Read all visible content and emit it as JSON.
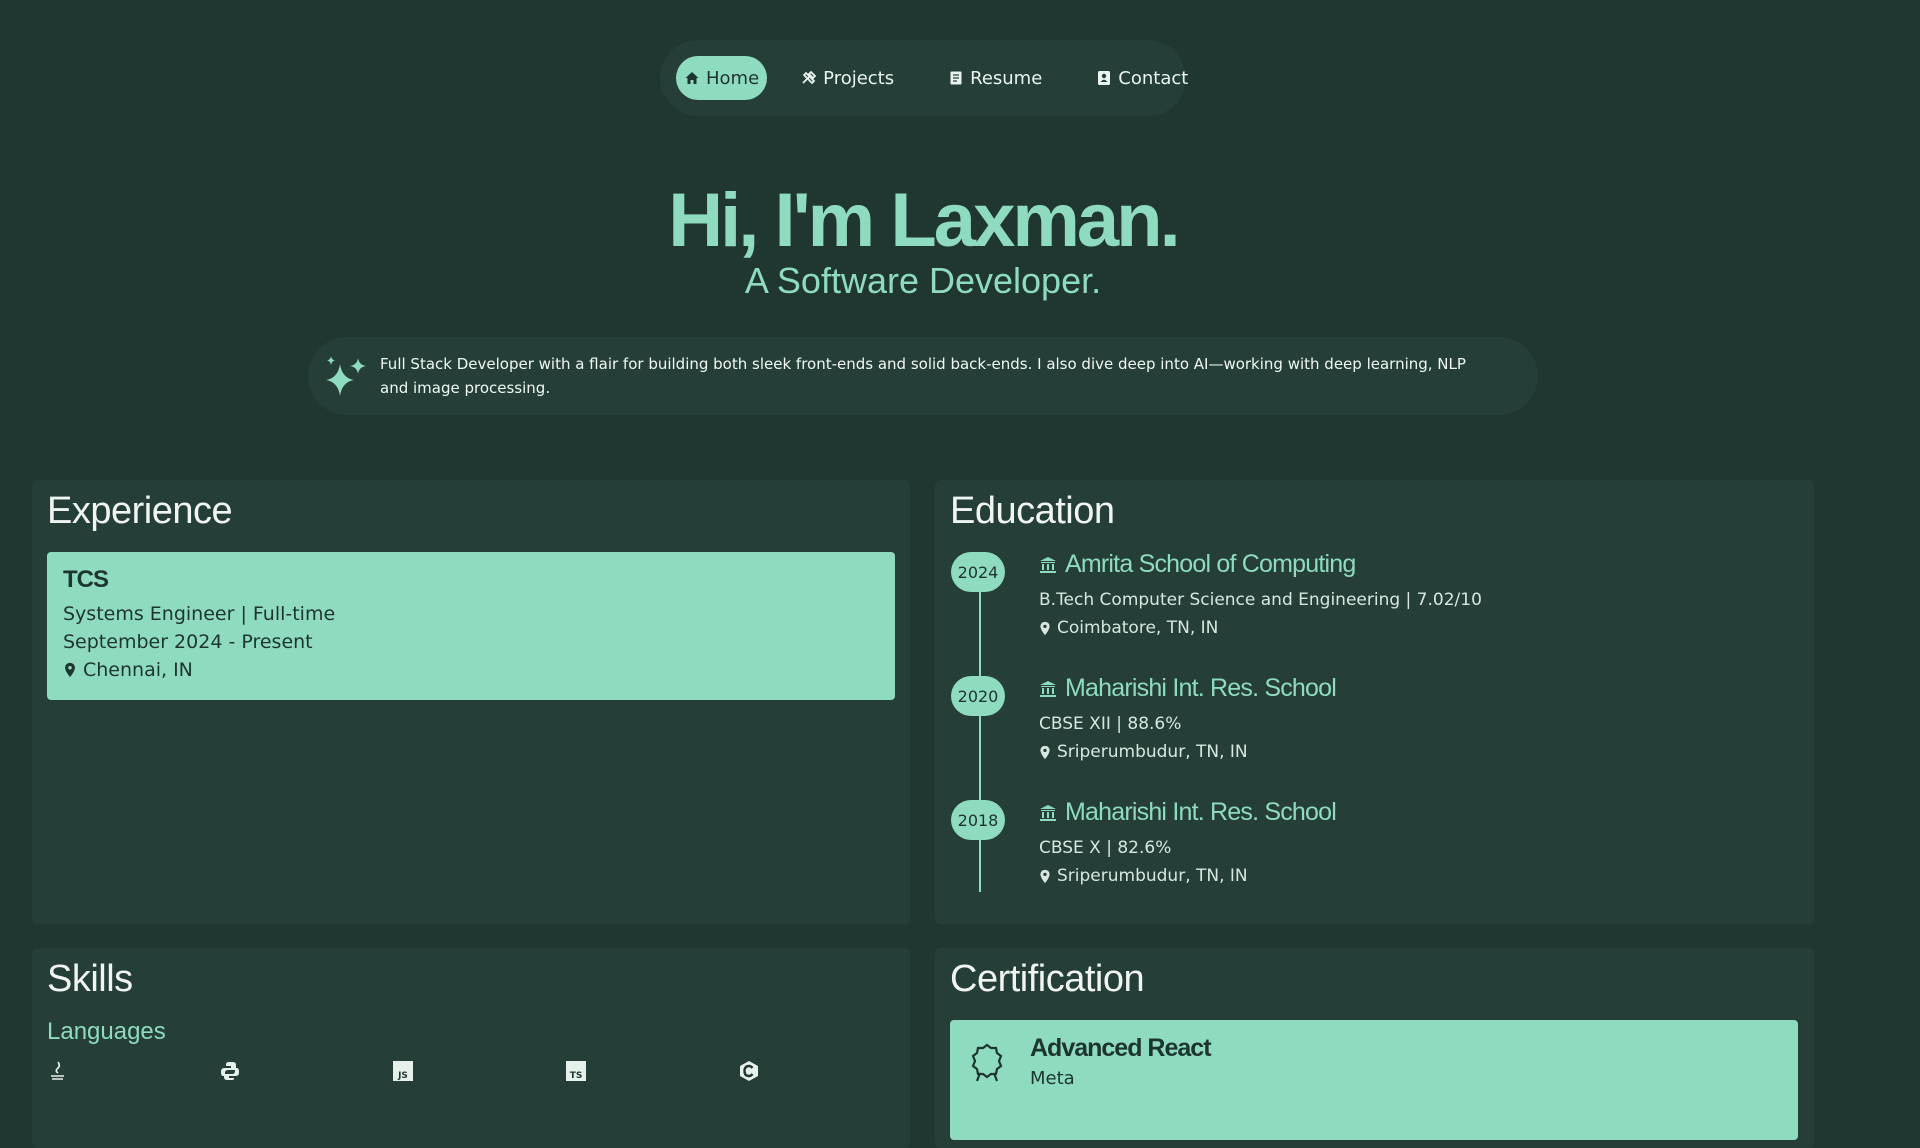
{
  "nav": {
    "items": [
      {
        "label": "Home",
        "icon": "home-icon",
        "active": true
      },
      {
        "label": "Projects",
        "icon": "tools-icon",
        "active": false
      },
      {
        "label": "Resume",
        "icon": "document-icon",
        "active": false
      },
      {
        "label": "Contact",
        "icon": "contact-card-icon",
        "active": false
      }
    ]
  },
  "hero": {
    "title": "Hi, I'm Laxman.",
    "subtitle": "A Software Developer.",
    "intro": "Full Stack Developer with a flair for building both sleek front-ends and solid back-ends. I also dive deep into AI—working with deep learning, NLP and image processing."
  },
  "experience": {
    "title": "Experience",
    "items": [
      {
        "company": "TCS",
        "role": "Systems Engineer | Full-time",
        "dates": "September 2024 - Present",
        "location": "Chennai, IN"
      }
    ]
  },
  "education": {
    "title": "Education",
    "items": [
      {
        "year": "2024",
        "school": "Amrita School of Computing",
        "detail": "B.Tech Computer Science and Engineering | 7.02/10",
        "location": "Coimbatore, TN, IN"
      },
      {
        "year": "2020",
        "school": "Maharishi Int. Res. School",
        "detail": "CBSE XII | 88.6%",
        "location": "Sriperumbudur, TN, IN"
      },
      {
        "year": "2018",
        "school": "Maharishi Int. Res. School",
        "detail": "CBSE X | 82.6%",
        "location": "Sriperumbudur, TN, IN"
      }
    ]
  },
  "skills": {
    "title": "Skills",
    "subtitle": "Languages",
    "icons": [
      "java-icon",
      "python-icon",
      "javascript-icon",
      "typescript-icon",
      "c-icon"
    ]
  },
  "certification": {
    "title": "Certification",
    "items": [
      {
        "title": "Advanced React",
        "issuer": "Meta"
      }
    ]
  },
  "colors": {
    "background": "#203731",
    "panel": "#253e38",
    "accent": "#8fdbc0"
  }
}
